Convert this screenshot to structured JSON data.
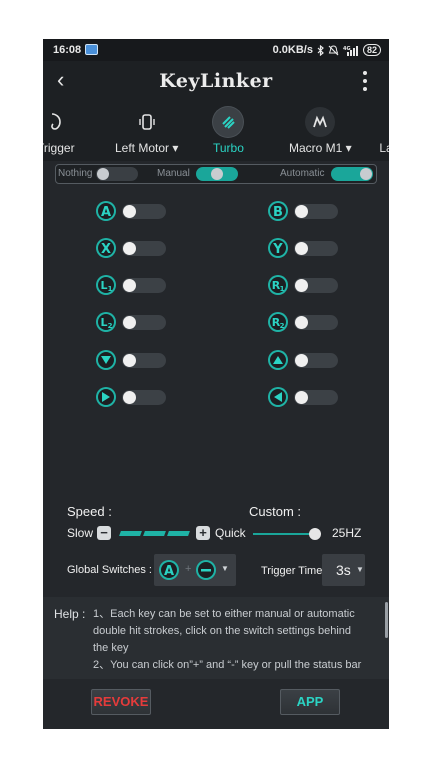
{
  "status": {
    "time": "16:08",
    "speed": "0.0KB/s",
    "battery": "82"
  },
  "appbar": {
    "title": "KeyLinker"
  },
  "tabs": [
    {
      "label": "Trigger",
      "icon": "trigger-icon"
    },
    {
      "label": "Left Motor ▾",
      "icon": "motor-icon"
    },
    {
      "label": "Turbo",
      "icon": "turbo-icon",
      "active": true
    },
    {
      "label": "Macro M1 ▾",
      "icon": "macro-icon"
    },
    {
      "label": "Lar",
      "icon": ""
    }
  ],
  "mode": {
    "nothing": "Nothing",
    "manual": "Manual",
    "automatic": "Automatic",
    "manual_on": true,
    "automatic_on": true
  },
  "keys": {
    "left": [
      "A",
      "X",
      "L1",
      "L2",
      "down",
      "right"
    ],
    "right": [
      "B",
      "Y",
      "R1",
      "R2",
      "up",
      "left"
    ],
    "all_off": true
  },
  "speed": {
    "label": "Speed :",
    "custom_label": "Custom :",
    "slow": "Slow",
    "quick": "Quick",
    "value": "25HZ",
    "level_segments": 3,
    "custom_level": 0.95
  },
  "global": {
    "label": "Global Switches :",
    "plus": "+",
    "trigger_label": "Trigger Time",
    "trigger_value": "3s"
  },
  "help": {
    "label": "Help :",
    "line1": "1、Each key can be set to either manual or automatic",
    "line2": "double hit strokes, click on the switch settings behind",
    "line3": "the key",
    "line4": "2、You can click on”+” and “-” key or pull the status bar"
  },
  "buttons": {
    "revoke": "REVOKE",
    "app": "APP"
  },
  "colors": {
    "accent": "#1fb3a6",
    "revoke": "#e53b3b",
    "app": "#2bd4c4"
  }
}
